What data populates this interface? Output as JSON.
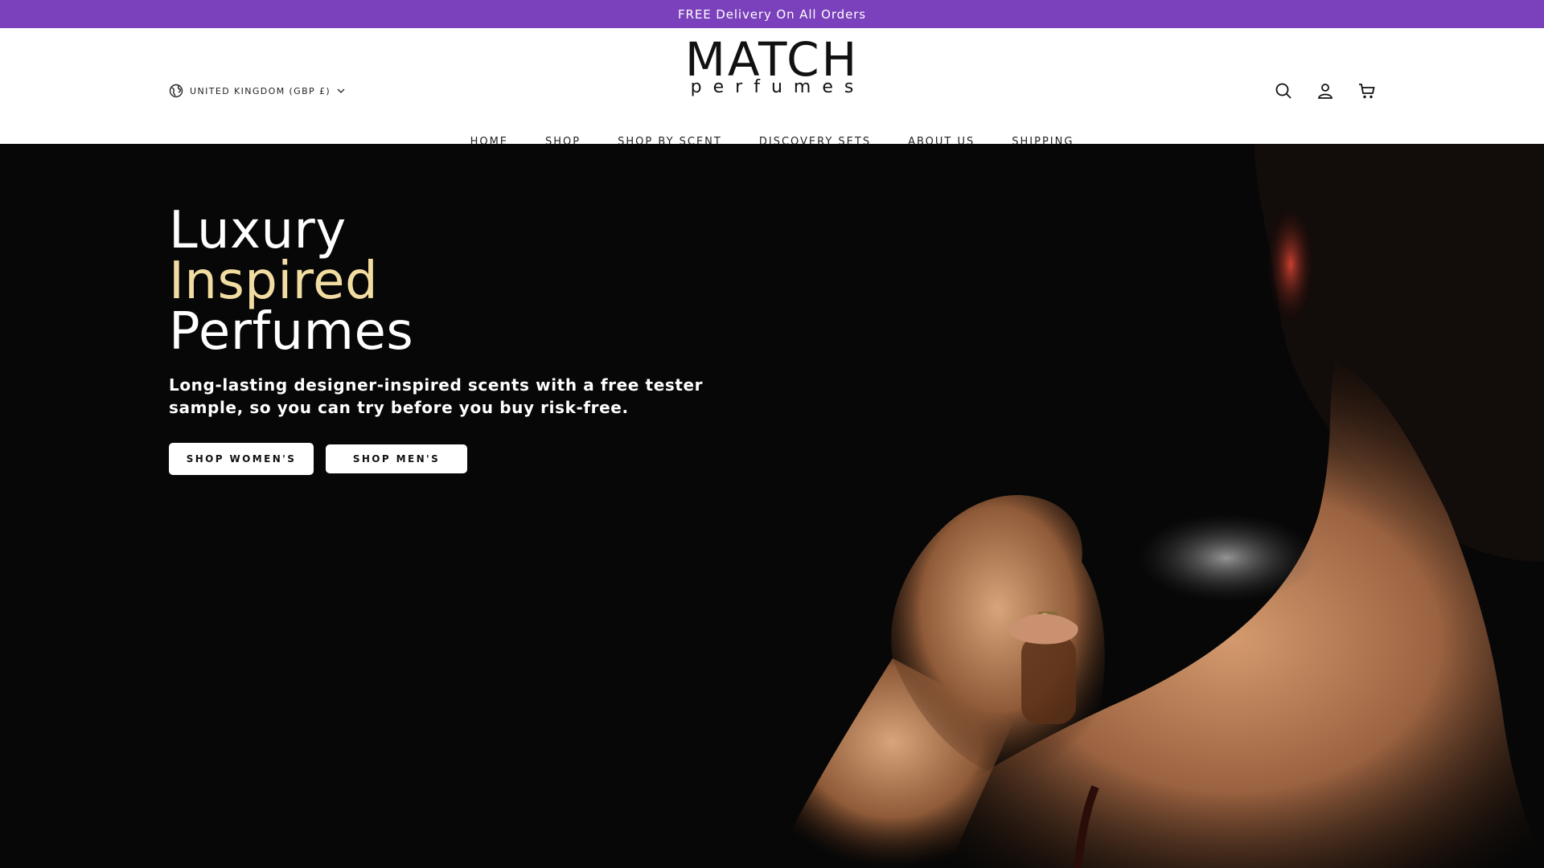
{
  "announcement": {
    "text": "FREE Delivery On All Orders"
  },
  "header": {
    "country_label": "UNITED KINGDOM (GBP £)",
    "logo": {
      "main": "MATCH",
      "sub": "perfumes"
    },
    "icons": [
      "search-icon",
      "account-icon",
      "cart-icon"
    ]
  },
  "nav": {
    "items": [
      {
        "label": "HOME"
      },
      {
        "label": "SHOP"
      },
      {
        "label": "SHOP BY SCENT"
      },
      {
        "label": "DISCOVERY SETS"
      },
      {
        "label": "ABOUT US"
      },
      {
        "label": "SHIPPING"
      }
    ]
  },
  "hero": {
    "title_line1": "Luxury",
    "title_line2": "Inspired",
    "title_line3": "Perfumes",
    "subtitle": "Long-lasting designer-inspired scents with a free tester sample, so you can try before you buy risk-free.",
    "button_women": "SHOP WOMEN'S",
    "button_men": "SHOP MEN'S"
  },
  "colors": {
    "announcement_bg": "#7b40bb",
    "hero_bg": "#070707",
    "accent_gold": "#f1dca2",
    "text_dark": "#222222"
  }
}
